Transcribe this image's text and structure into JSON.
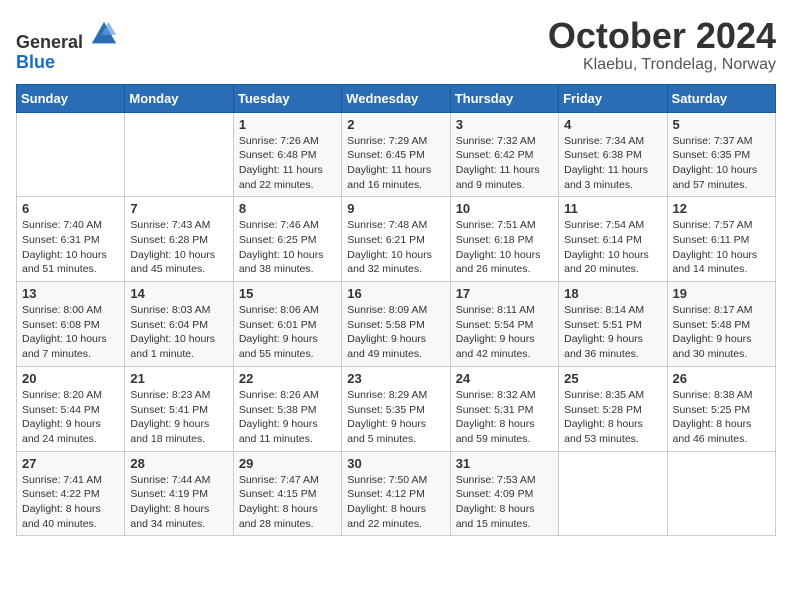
{
  "header": {
    "logo_general": "General",
    "logo_blue": "Blue",
    "month": "October 2024",
    "location": "Klaebu, Trondelag, Norway"
  },
  "days_of_week": [
    "Sunday",
    "Monday",
    "Tuesday",
    "Wednesday",
    "Thursday",
    "Friday",
    "Saturday"
  ],
  "weeks": [
    [
      {
        "day": "",
        "info": ""
      },
      {
        "day": "",
        "info": ""
      },
      {
        "day": "1",
        "info": "Sunrise: 7:26 AM\nSunset: 6:48 PM\nDaylight: 11 hours\nand 22 minutes."
      },
      {
        "day": "2",
        "info": "Sunrise: 7:29 AM\nSunset: 6:45 PM\nDaylight: 11 hours\nand 16 minutes."
      },
      {
        "day": "3",
        "info": "Sunrise: 7:32 AM\nSunset: 6:42 PM\nDaylight: 11 hours\nand 9 minutes."
      },
      {
        "day": "4",
        "info": "Sunrise: 7:34 AM\nSunset: 6:38 PM\nDaylight: 11 hours\nand 3 minutes."
      },
      {
        "day": "5",
        "info": "Sunrise: 7:37 AM\nSunset: 6:35 PM\nDaylight: 10 hours\nand 57 minutes."
      }
    ],
    [
      {
        "day": "6",
        "info": "Sunrise: 7:40 AM\nSunset: 6:31 PM\nDaylight: 10 hours\nand 51 minutes."
      },
      {
        "day": "7",
        "info": "Sunrise: 7:43 AM\nSunset: 6:28 PM\nDaylight: 10 hours\nand 45 minutes."
      },
      {
        "day": "8",
        "info": "Sunrise: 7:46 AM\nSunset: 6:25 PM\nDaylight: 10 hours\nand 38 minutes."
      },
      {
        "day": "9",
        "info": "Sunrise: 7:48 AM\nSunset: 6:21 PM\nDaylight: 10 hours\nand 32 minutes."
      },
      {
        "day": "10",
        "info": "Sunrise: 7:51 AM\nSunset: 6:18 PM\nDaylight: 10 hours\nand 26 minutes."
      },
      {
        "day": "11",
        "info": "Sunrise: 7:54 AM\nSunset: 6:14 PM\nDaylight: 10 hours\nand 20 minutes."
      },
      {
        "day": "12",
        "info": "Sunrise: 7:57 AM\nSunset: 6:11 PM\nDaylight: 10 hours\nand 14 minutes."
      }
    ],
    [
      {
        "day": "13",
        "info": "Sunrise: 8:00 AM\nSunset: 6:08 PM\nDaylight: 10 hours\nand 7 minutes."
      },
      {
        "day": "14",
        "info": "Sunrise: 8:03 AM\nSunset: 6:04 PM\nDaylight: 10 hours\nand 1 minute."
      },
      {
        "day": "15",
        "info": "Sunrise: 8:06 AM\nSunset: 6:01 PM\nDaylight: 9 hours\nand 55 minutes."
      },
      {
        "day": "16",
        "info": "Sunrise: 8:09 AM\nSunset: 5:58 PM\nDaylight: 9 hours\nand 49 minutes."
      },
      {
        "day": "17",
        "info": "Sunrise: 8:11 AM\nSunset: 5:54 PM\nDaylight: 9 hours\nand 42 minutes."
      },
      {
        "day": "18",
        "info": "Sunrise: 8:14 AM\nSunset: 5:51 PM\nDaylight: 9 hours\nand 36 minutes."
      },
      {
        "day": "19",
        "info": "Sunrise: 8:17 AM\nSunset: 5:48 PM\nDaylight: 9 hours\nand 30 minutes."
      }
    ],
    [
      {
        "day": "20",
        "info": "Sunrise: 8:20 AM\nSunset: 5:44 PM\nDaylight: 9 hours\nand 24 minutes."
      },
      {
        "day": "21",
        "info": "Sunrise: 8:23 AM\nSunset: 5:41 PM\nDaylight: 9 hours\nand 18 minutes."
      },
      {
        "day": "22",
        "info": "Sunrise: 8:26 AM\nSunset: 5:38 PM\nDaylight: 9 hours\nand 11 minutes."
      },
      {
        "day": "23",
        "info": "Sunrise: 8:29 AM\nSunset: 5:35 PM\nDaylight: 9 hours\nand 5 minutes."
      },
      {
        "day": "24",
        "info": "Sunrise: 8:32 AM\nSunset: 5:31 PM\nDaylight: 8 hours\nand 59 minutes."
      },
      {
        "day": "25",
        "info": "Sunrise: 8:35 AM\nSunset: 5:28 PM\nDaylight: 8 hours\nand 53 minutes."
      },
      {
        "day": "26",
        "info": "Sunrise: 8:38 AM\nSunset: 5:25 PM\nDaylight: 8 hours\nand 46 minutes."
      }
    ],
    [
      {
        "day": "27",
        "info": "Sunrise: 7:41 AM\nSunset: 4:22 PM\nDaylight: 8 hours\nand 40 minutes."
      },
      {
        "day": "28",
        "info": "Sunrise: 7:44 AM\nSunset: 4:19 PM\nDaylight: 8 hours\nand 34 minutes."
      },
      {
        "day": "29",
        "info": "Sunrise: 7:47 AM\nSunset: 4:15 PM\nDaylight: 8 hours\nand 28 minutes."
      },
      {
        "day": "30",
        "info": "Sunrise: 7:50 AM\nSunset: 4:12 PM\nDaylight: 8 hours\nand 22 minutes."
      },
      {
        "day": "31",
        "info": "Sunrise: 7:53 AM\nSunset: 4:09 PM\nDaylight: 8 hours\nand 15 minutes."
      },
      {
        "day": "",
        "info": ""
      },
      {
        "day": "",
        "info": ""
      }
    ]
  ]
}
